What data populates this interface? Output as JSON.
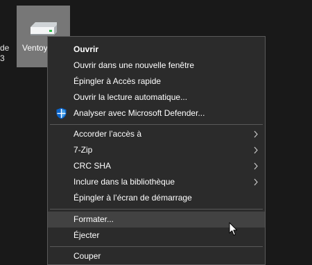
{
  "background": {
    "left_text": [
      "de",
      "3",
      ""
    ],
    "drive": {
      "label": "Ventoy",
      "icon": "usb-drive-icon"
    }
  },
  "context_menu": {
    "items": [
      {
        "label": "Ouvrir",
        "bold": true
      },
      {
        "label": "Ouvrir dans une nouvelle fenêtre"
      },
      {
        "label": "Épingler à Accès rapide"
      },
      {
        "label": "Ouvrir la lecture automatique..."
      },
      {
        "label": "Analyser avec Microsoft Defender...",
        "icon": "defender-shield-icon"
      },
      {
        "label": "Accorder l’accès à",
        "submenu": true
      },
      {
        "label": "7-Zip",
        "submenu": true
      },
      {
        "label": "CRC SHA",
        "submenu": true
      },
      {
        "label": "Inclure dans la bibliothèque",
        "submenu": true
      },
      {
        "label": "Épingler à l’écran de démarrage"
      },
      {
        "label": "Formater...",
        "highlighted": true
      },
      {
        "label": "Éjecter"
      },
      {
        "label": "Couper"
      }
    ]
  },
  "colors": {
    "background": "#191919",
    "menu_bg": "#2b2b2b",
    "menu_border": "#5a5a5a",
    "highlight": "#424242",
    "selected_tile": "#777777",
    "defender_blue": "#0a63c9"
  }
}
